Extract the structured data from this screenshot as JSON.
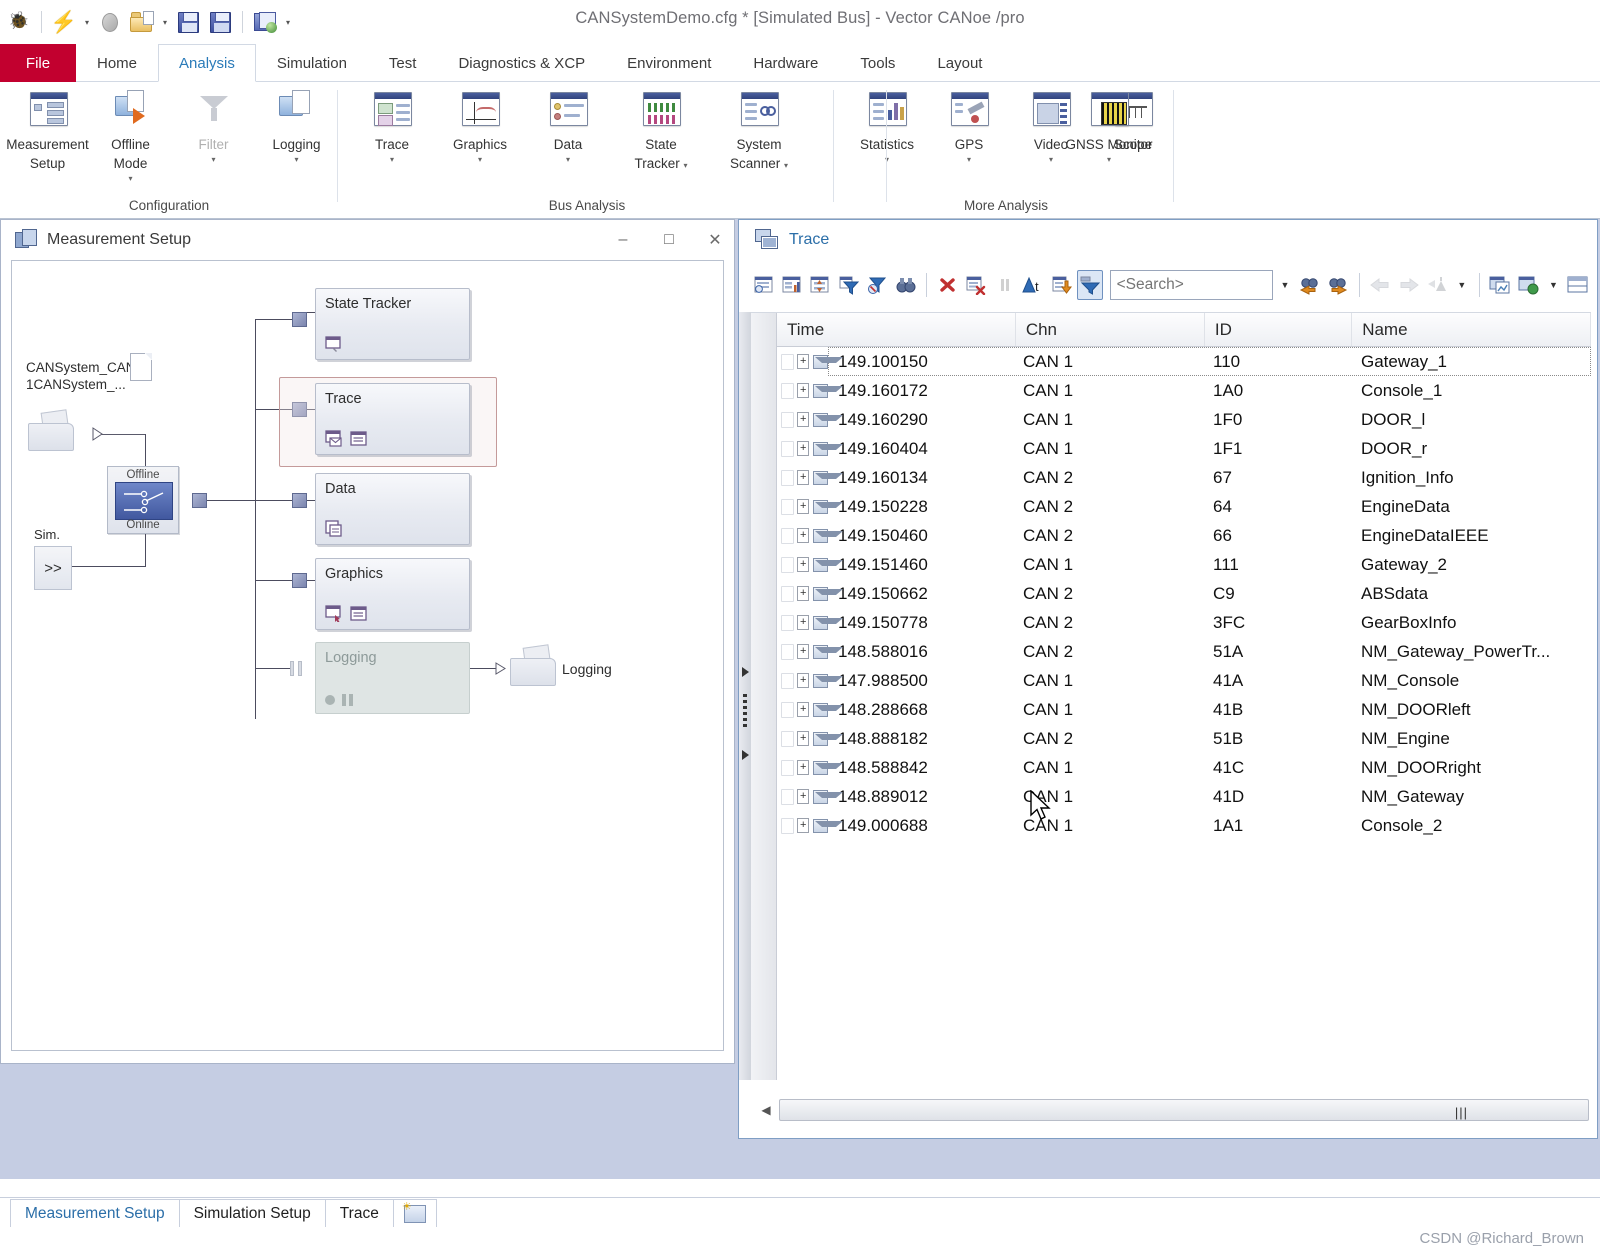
{
  "titlebar": {
    "title": "CANSystemDemo.cfg * [Simulated Bus] - Vector CANoe /pro",
    "quick_access": [
      {
        "name": "canoe-logo-icon",
        "label": "CANoe"
      },
      {
        "name": "lightning-icon",
        "label": "Start"
      },
      {
        "name": "stop-icon",
        "label": "Stop"
      },
      {
        "name": "open-folder-icon",
        "label": "Open"
      },
      {
        "name": "save-icon",
        "label": "Save"
      },
      {
        "name": "save-as-icon",
        "label": "Save As"
      },
      {
        "name": "save-all-icon",
        "label": "Save All"
      }
    ]
  },
  "ribbon": {
    "file_tab": "File",
    "tabs": [
      {
        "label": "Home",
        "active": false
      },
      {
        "label": "Analysis",
        "active": true
      },
      {
        "label": "Simulation",
        "active": false
      },
      {
        "label": "Test",
        "active": false
      },
      {
        "label": "Diagnostics & XCP",
        "active": false
      },
      {
        "label": "Environment",
        "active": false
      },
      {
        "label": "Hardware",
        "active": false
      },
      {
        "label": "Tools",
        "active": false
      },
      {
        "label": "Layout",
        "active": false
      }
    ],
    "groups": [
      {
        "name": "Configuration",
        "buttons": [
          {
            "label": "Measurement\nSetup",
            "line1": "Measurement",
            "line2": "Setup",
            "dropdown": false,
            "disabled": false,
            "icon": "measurement-setup-icon"
          },
          {
            "label": "Offline Mode",
            "line1": "Offline",
            "line2": "Mode",
            "dropdown": true,
            "disabled": false,
            "icon": "offline-mode-icon"
          },
          {
            "label": "Filter",
            "line1": "Filter",
            "line2": "",
            "dropdown": true,
            "disabled": true,
            "icon": "filter-icon"
          },
          {
            "label": "Logging",
            "line1": "Logging",
            "line2": "",
            "dropdown": true,
            "disabled": false,
            "icon": "logging-icon"
          }
        ]
      },
      {
        "name": "Bus Analysis",
        "buttons": [
          {
            "label": "Trace",
            "line1": "Trace",
            "line2": "",
            "dropdown": true,
            "disabled": false,
            "icon": "trace-icon"
          },
          {
            "label": "Graphics",
            "line1": "Graphics",
            "line2": "",
            "dropdown": true,
            "disabled": false,
            "icon": "graphics-icon"
          },
          {
            "label": "Data",
            "line1": "Data",
            "line2": "",
            "dropdown": true,
            "disabled": false,
            "icon": "data-icon"
          },
          {
            "label": "State Tracker",
            "line1": "State",
            "line2": "Tracker",
            "dropdown": true,
            "inline_arrow": true,
            "disabled": false,
            "icon": "state-tracker-icon"
          },
          {
            "label": "System Scanner",
            "line1": "System",
            "line2": "Scanner",
            "dropdown": true,
            "inline_arrow": true,
            "disabled": false,
            "icon": "system-scanner-icon"
          }
        ]
      },
      {
        "name": "More Analysis",
        "buttons": [
          {
            "label": "Statistics",
            "line1": "Statistics",
            "line2": "",
            "dropdown": true,
            "disabled": false,
            "icon": "statistics-icon"
          },
          {
            "label": "GPS",
            "line1": "GPS",
            "line2": "",
            "dropdown": true,
            "disabled": false,
            "icon": "gps-icon"
          },
          {
            "label": "Video",
            "line1": "Video",
            "line2": "",
            "dropdown": true,
            "disabled": false,
            "icon": "video-icon"
          },
          {
            "label": "Scope",
            "line1": "Scope",
            "line2": "",
            "dropdown": false,
            "disabled": false,
            "icon": "scope-icon"
          },
          {
            "label": "GNSS Monitor",
            "line1": "GNSS Monitor",
            "line2": "",
            "dropdown": true,
            "disabled": false,
            "icon": "gnss-monitor-icon"
          }
        ]
      }
    ]
  },
  "measurement_setup": {
    "window_title": "Measurement Setup",
    "window_buttons": {
      "minimize": "–",
      "maximize": "□",
      "close": "✕"
    },
    "source_label_line1": "CANSystem_CAN",
    "source_label_line2": "1CANSystem_...",
    "switch": {
      "top_label": "Offline",
      "bottom_label": "Online"
    },
    "sim_label": "Sim.",
    "sim_button": ">>",
    "logging_output_label": "Logging",
    "nodes": [
      {
        "title": "State Tracker",
        "selected": false,
        "disabled": false,
        "icons": [
          "window-icon"
        ]
      },
      {
        "title": "Trace",
        "selected": true,
        "disabled": false,
        "icons": [
          "window-mail-icon",
          "list-icon"
        ]
      },
      {
        "title": "Data",
        "selected": false,
        "disabled": false,
        "icons": [
          "panel-icon"
        ]
      },
      {
        "title": "Graphics",
        "selected": false,
        "disabled": false,
        "icons": [
          "window-cursor-icon",
          "list-icon"
        ]
      },
      {
        "title": "Logging",
        "selected": false,
        "disabled": true,
        "icons": [
          "record-icon",
          "pause-icon"
        ]
      }
    ]
  },
  "trace": {
    "window_title": "Trace",
    "toolbar": [
      {
        "name": "show-time-icon",
        "state": "normal"
      },
      {
        "name": "statistics-columns-icon",
        "state": "normal"
      },
      {
        "name": "expand-collapse-icon",
        "state": "normal"
      },
      {
        "name": "filter-icon",
        "state": "normal"
      },
      {
        "name": "remove-filter-icon",
        "state": "normal"
      },
      {
        "name": "find-binoculars-icon",
        "state": "normal"
      },
      {
        "name": "clear-red-x-icon",
        "state": "normal"
      },
      {
        "name": "clear-list-icon",
        "state": "normal"
      },
      {
        "name": "pause-icon",
        "state": "disabled"
      },
      {
        "name": "absolute-time-icon",
        "state": "normal"
      },
      {
        "name": "export-icon",
        "state": "normal"
      },
      {
        "name": "analysis-filter-icon",
        "state": "active"
      }
    ],
    "toolbar_right": [
      {
        "name": "find-previous-icon",
        "state": "normal"
      },
      {
        "name": "find-next-icon",
        "state": "normal"
      },
      {
        "name": "nav-back-icon",
        "state": "disabled"
      },
      {
        "name": "nav-forward-icon",
        "state": "disabled"
      },
      {
        "name": "marker-icon",
        "state": "disabled"
      },
      {
        "name": "copy-window-icon",
        "state": "normal"
      },
      {
        "name": "new-window-icon",
        "state": "normal"
      },
      {
        "name": "layout-icon",
        "state": "normal"
      }
    ],
    "search": {
      "value": "",
      "placeholder": "<Search>"
    },
    "columns": [
      "Time",
      "Chn",
      "ID",
      "Name"
    ],
    "rows": [
      {
        "time": "149.100150",
        "chn": "CAN 1",
        "id": "110",
        "name": "Gateway_1"
      },
      {
        "time": "149.160172",
        "chn": "CAN 1",
        "id": "1A0",
        "name": "Console_1"
      },
      {
        "time": "149.160290",
        "chn": "CAN 1",
        "id": "1F0",
        "name": "DOOR_l"
      },
      {
        "time": "149.160404",
        "chn": "CAN 1",
        "id": "1F1",
        "name": "DOOR_r"
      },
      {
        "time": "149.160134",
        "chn": "CAN 2",
        "id": "67",
        "name": "Ignition_Info"
      },
      {
        "time": "149.150228",
        "chn": "CAN 2",
        "id": "64",
        "name": "EngineData"
      },
      {
        "time": "149.150460",
        "chn": "CAN 2",
        "id": "66",
        "name": "EngineDataIEEE"
      },
      {
        "time": "149.151460",
        "chn": "CAN 1",
        "id": "111",
        "name": "Gateway_2"
      },
      {
        "time": "149.150662",
        "chn": "CAN 2",
        "id": "C9",
        "name": "ABSdata"
      },
      {
        "time": "149.150778",
        "chn": "CAN 2",
        "id": "3FC",
        "name": "GearBoxInfo"
      },
      {
        "time": "148.588016",
        "chn": "CAN 2",
        "id": "51A",
        "name": "NM_Gateway_PowerTr..."
      },
      {
        "time": "147.988500",
        "chn": "CAN 1",
        "id": "41A",
        "name": "NM_Console"
      },
      {
        "time": "148.288668",
        "chn": "CAN 1",
        "id": "41B",
        "name": "NM_DOORleft"
      },
      {
        "time": "148.888182",
        "chn": "CAN 2",
        "id": "51B",
        "name": "NM_Engine"
      },
      {
        "time": "148.588842",
        "chn": "CAN 1",
        "id": "41C",
        "name": "NM_DOORright"
      },
      {
        "time": "148.889012",
        "chn": "CAN 1",
        "id": "41D",
        "name": "NM_Gateway"
      },
      {
        "time": "149.000688",
        "chn": "CAN 1",
        "id": "1A1",
        "name": "Console_2"
      }
    ]
  },
  "bottom_tabs": [
    {
      "label": "Measurement Setup",
      "active": true
    },
    {
      "label": "Simulation Setup",
      "active": false
    },
    {
      "label": "Trace",
      "active": false
    }
  ],
  "watermark": "CSDN @Richard_Brown"
}
